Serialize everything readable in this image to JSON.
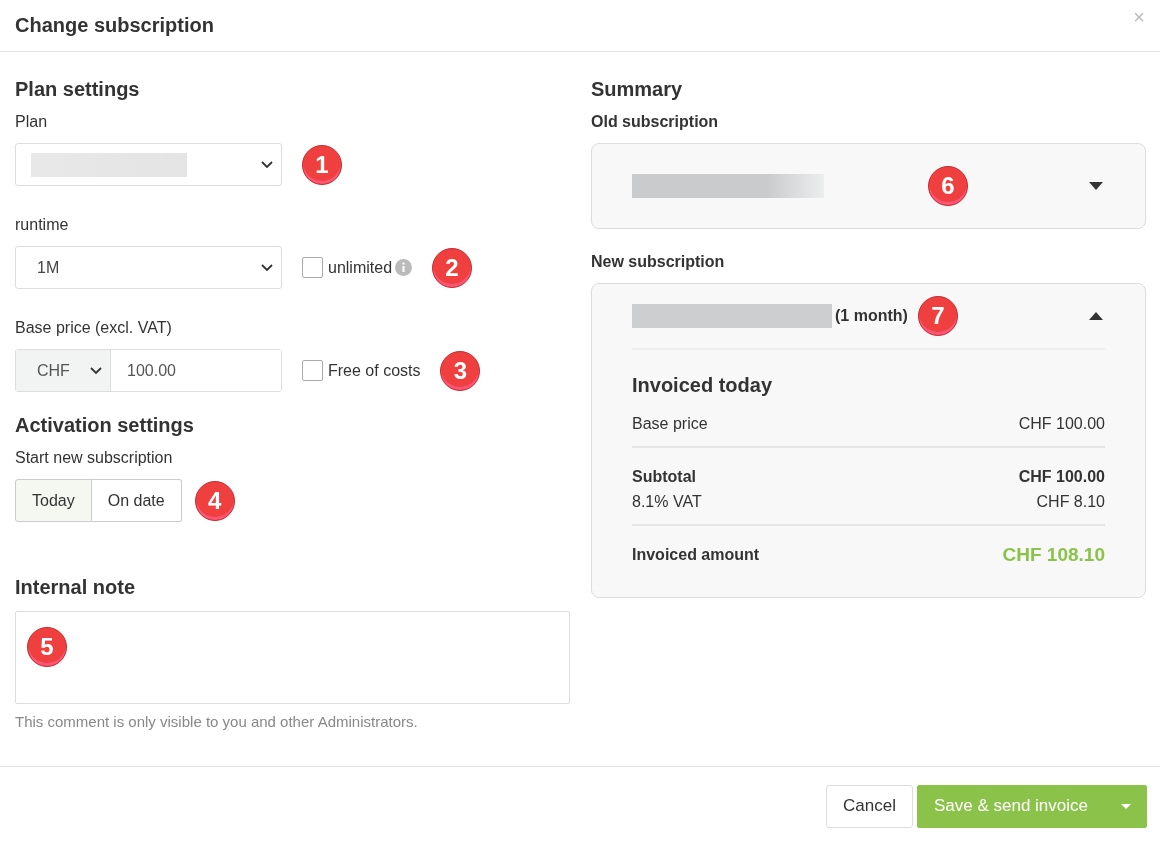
{
  "window": {
    "title": "Change subscription",
    "close": "×"
  },
  "plan_settings": {
    "heading": "Plan settings",
    "plan": {
      "label": "Plan",
      "callout": "1"
    },
    "runtime": {
      "label": "runtime",
      "value": "1M",
      "option": {
        "label": "unlimited",
        "checked": false
      },
      "callout": "2"
    },
    "base_price": {
      "label": "Base price (excl. VAT)",
      "currency": "CHF",
      "value": "100.00",
      "option": {
        "label": "Free of costs",
        "checked": false
      },
      "callout": "3"
    }
  },
  "activation_settings": {
    "heading": "Activation settings",
    "label": "Start new subscription",
    "options": [
      {
        "label": "Today",
        "selected": true
      },
      {
        "label": "On date",
        "selected": false
      }
    ],
    "callout": "4"
  },
  "internal_note": {
    "heading": "Internal note",
    "callout": "5",
    "hint": "This comment is only visible to you and other Administrators."
  },
  "summary": {
    "heading": "Summary",
    "old_subscription": {
      "label": "Old subscription",
      "expanded": false,
      "callout": "6"
    },
    "new_subscription": {
      "label": "New subscription",
      "period": "(1 month)",
      "expanded": true,
      "callout": "7",
      "section_title": "Invoiced today",
      "groups": [
        [
          {
            "kind": "item",
            "label": "Base price",
            "value": "CHF 100.00"
          }
        ],
        [
          {
            "kind": "subtotal",
            "label": "Subtotal",
            "value": "CHF 100.00"
          },
          {
            "kind": "item",
            "label": "8.1% VAT",
            "value": "CHF 8.10"
          }
        ],
        [
          {
            "kind": "total",
            "label": "Invoiced amount",
            "value": "CHF 108.10"
          }
        ]
      ]
    }
  },
  "buttons": {
    "cancel": "Cancel",
    "save": "Save & send invoice"
  }
}
